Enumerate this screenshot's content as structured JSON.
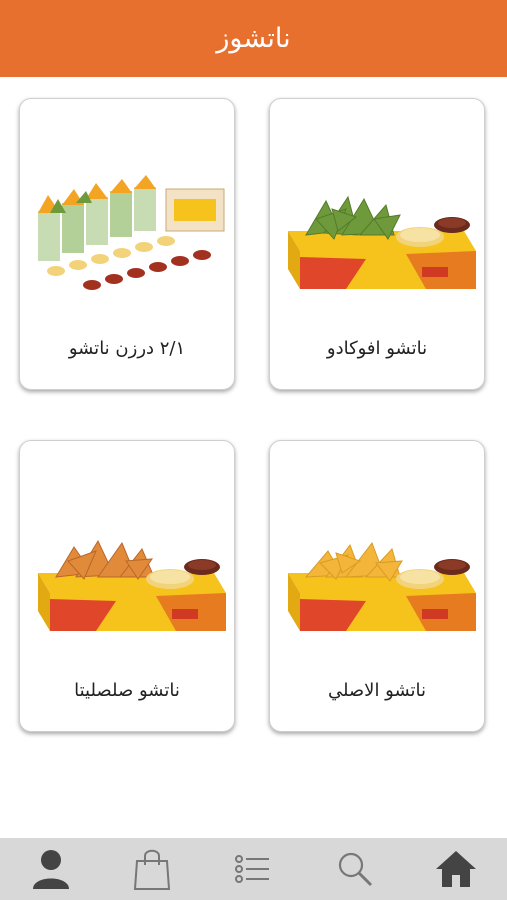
{
  "header": {
    "title": "ناتشوز"
  },
  "products": [
    {
      "name": "ناتشو افوكادو"
    },
    {
      "name": "٢/١ درزن ناتشو"
    },
    {
      "name": "ناتشو الاصلي"
    },
    {
      "name": "ناتشو صلصليتا"
    }
  ],
  "bottom_nav": {
    "items": [
      "home-icon",
      "search-icon",
      "list-icon",
      "bag-icon",
      "user-icon"
    ]
  },
  "colors": {
    "header": "#e8702e",
    "nav_bg": "#d8d8d8",
    "box_yellow": "#f6c21c",
    "box_red": "#e0472a"
  }
}
